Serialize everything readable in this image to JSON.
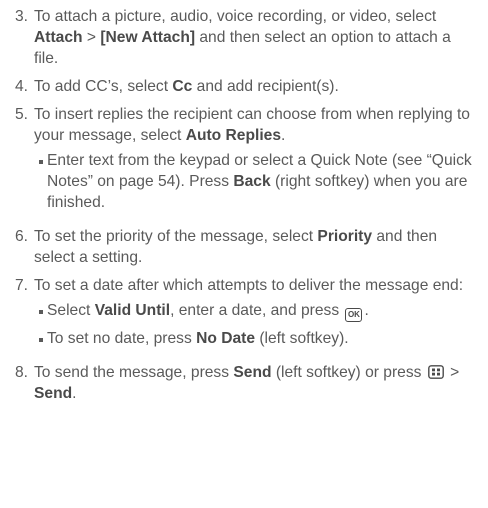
{
  "steps": [
    {
      "number": "3.",
      "t1": "To attach a picture, audio, voice recording, or video, select ",
      "b1": "Attach",
      "t2": " > ",
      "b2": "[New Attach]",
      "t3": " and then select an option to attach a file."
    },
    {
      "number": "4.",
      "t1": "To add CC’s, select ",
      "b1": "Cc",
      "t2": " and add recipient(s)."
    },
    {
      "number": "5.",
      "t1": "To insert replies the recipient can choose from when replying to your message, select ",
      "b1": "Auto Replies",
      "t2": ".",
      "sub": {
        "t1": "Enter text from the keypad or select a Quick Note (see “Quick Notes” on page 54). Press ",
        "b1": "Back",
        "t2": " (right softkey) when you are finished."
      }
    },
    {
      "number": "6.",
      "t1": "To set the priority of the message, select ",
      "b1": "Priority",
      "t2": " and then select a setting."
    },
    {
      "number": "7.",
      "t1": "To set a date after which attempts to deliver the message end:",
      "subs": [
        {
          "t1": "Select ",
          "b1": "Valid Until",
          "t2": ", enter a date, and press ",
          "icon": "OK",
          "t3": "."
        },
        {
          "t1": "To set no date, press ",
          "b1": "No Date",
          "t2": " (left softkey)."
        }
      ]
    },
    {
      "number": "8.",
      "t1": "To send the message, press ",
      "b1": "Send",
      "t2": " (left softkey) or press ",
      "icon": "menu-key-icon",
      "t3": " > ",
      "b2": "Send",
      "t4": "."
    }
  ]
}
